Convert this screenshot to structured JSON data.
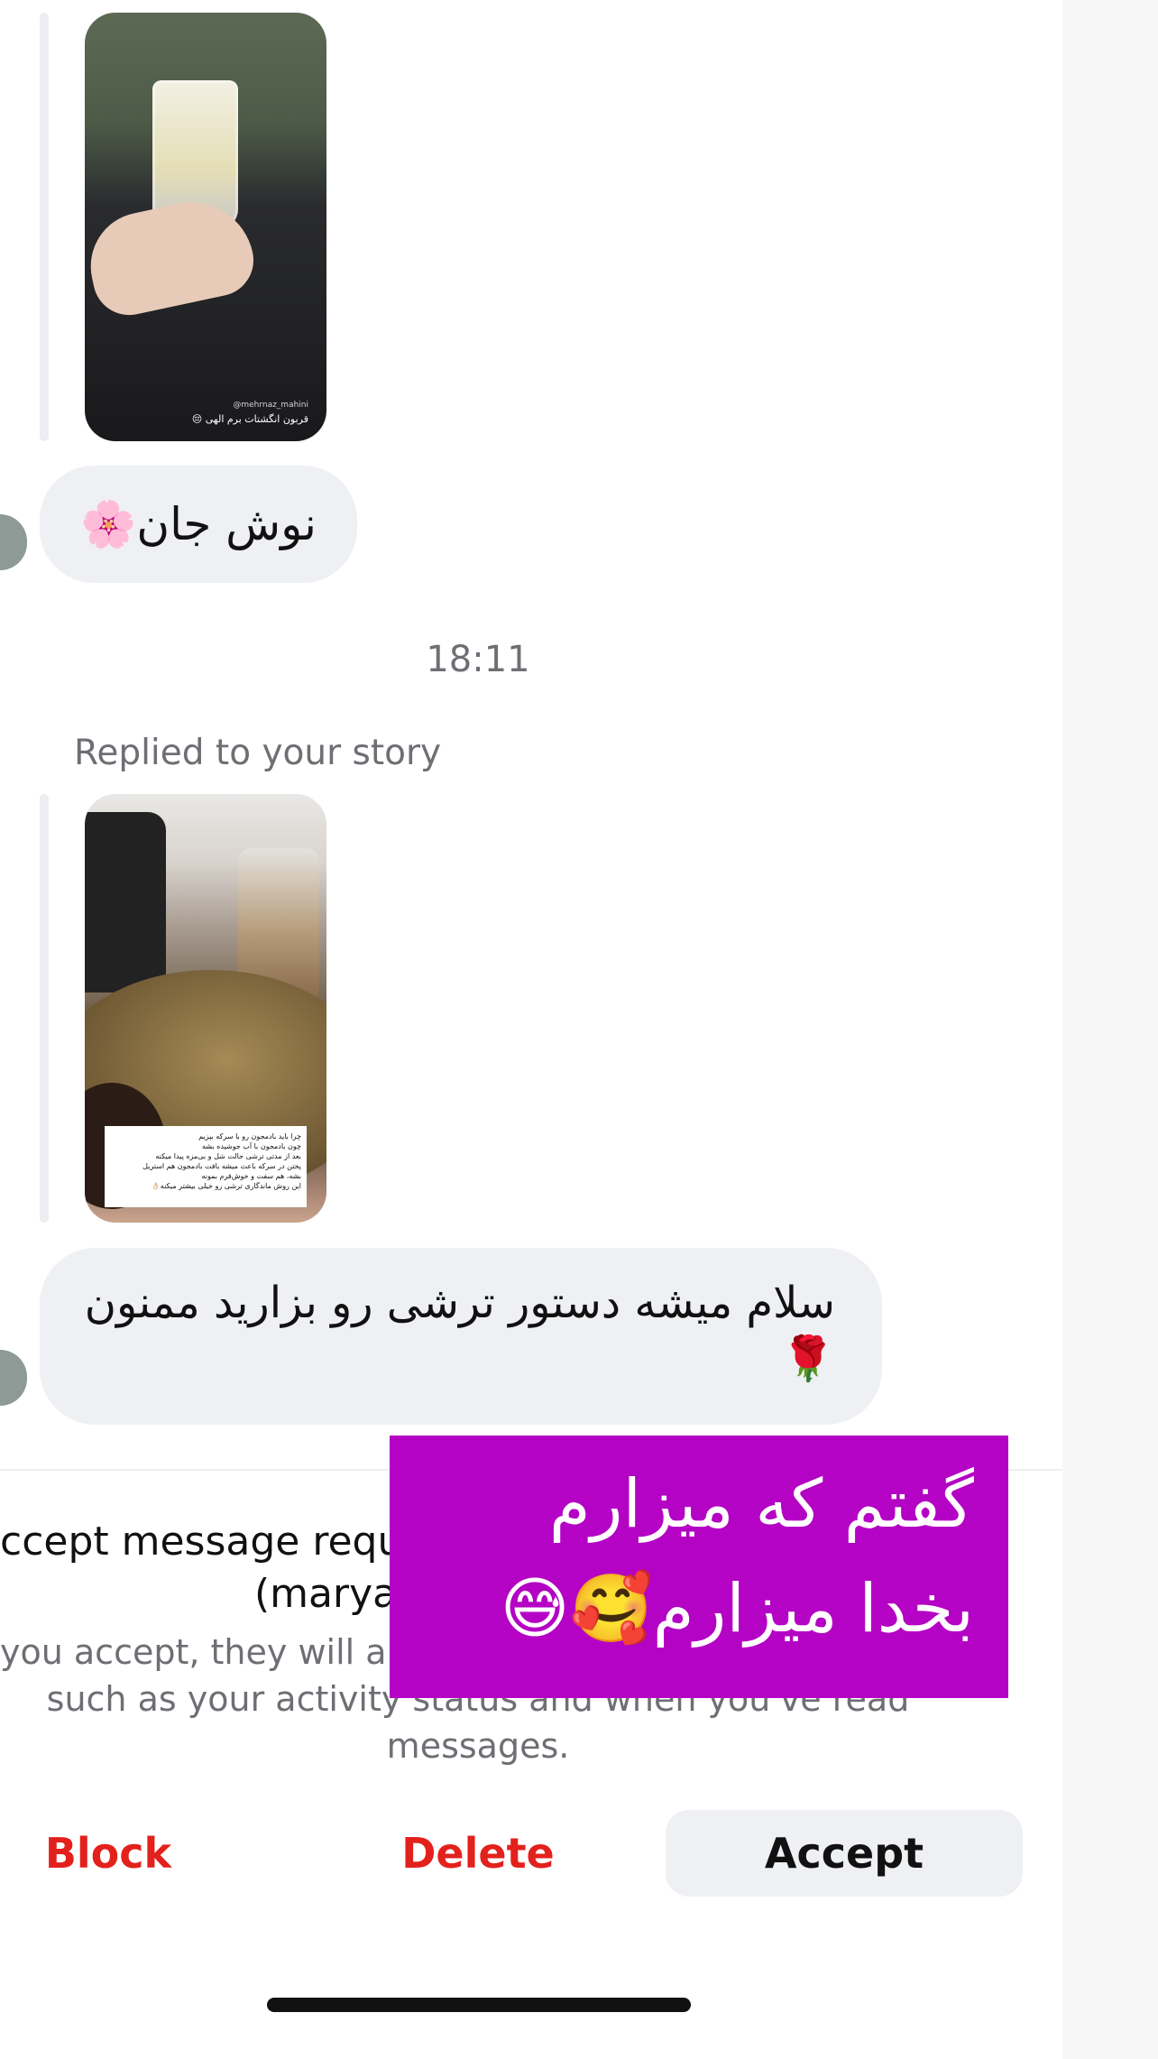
{
  "colors": {
    "accent_red": "#e3211c",
    "overlay_purple": "#b403c4",
    "bubble_bg": "#eff0f3",
    "muted_text": "#6e6f74"
  },
  "thread": {
    "story1": {
      "caption": "قربون انگشتات برم الهی 😔",
      "handle": "@mehrnaz_mahini"
    },
    "message1": {
      "text": "نوش جان🌸"
    },
    "timestamp": "18:11",
    "reply_label": "Replied to your story",
    "story2": {
      "note": "چرا باید بادمجون رو با سرکه بپزیم\nچون بادمجون با آب جوشیده بشه\nبعد از مدتی ترشی حالت شل و بی‌مزه پیدا میکنه\nپختن در سرکه باعث میشه بافت بادمجون هم استریل\nبشه، هم سفت و خوش‌فرم بمونه\nاین روش ماندگاری ترشی رو خیلی بیشتر میکنه👌🏻"
    },
    "message2": {
      "text": "سلام میشه دستور ترشی رو بزارید ممنون 🌹"
    }
  },
  "request": {
    "title_line1": "ccept message requ",
    "title_line2": "(marya",
    "body_line1": "you accept, they will al",
    "body_line2": "such as your activity status and when you've read",
    "body_line3": "messages."
  },
  "actions": {
    "block": "Block",
    "delete": "Delete",
    "accept": "Accept"
  },
  "overlay": {
    "line1": "گفتم که میزارم",
    "line2": "بخدا میزارم🥰😅"
  }
}
